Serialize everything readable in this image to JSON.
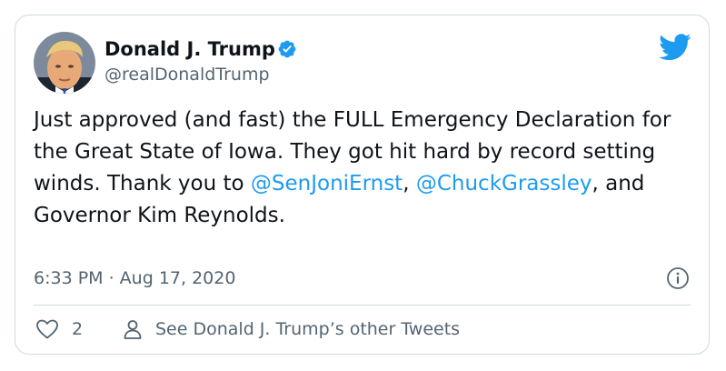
{
  "author": {
    "display_name": "Donald J. Trump",
    "handle": "@realDonaldTrump",
    "verified": true
  },
  "tweet": {
    "text_part1": "Just approved (and fast) the FULL Emergency Declaration for the Great State of Iowa. They got hit hard by record setting winds. Thank you to ",
    "mention1": "@SenJoniErnst",
    "text_part2": ", ",
    "mention2": "@ChuckGrassley",
    "text_part3": ", and Governor Kim Reynolds."
  },
  "timestamp": "6:33 PM · Aug 17, 2020",
  "actions": {
    "like_count": "2",
    "other_tweets_label": "See Donald J. Trump’s other Tweets"
  },
  "icons": {
    "brand": "twitter-bird-icon",
    "verified": "verified-badge-icon",
    "info": "info-icon",
    "like": "heart-icon",
    "profile": "person-icon"
  },
  "colors": {
    "link": "#1d9bf0",
    "secondary_text": "#536471",
    "border": "#cfd9de",
    "brand": "#1d9bf0"
  }
}
